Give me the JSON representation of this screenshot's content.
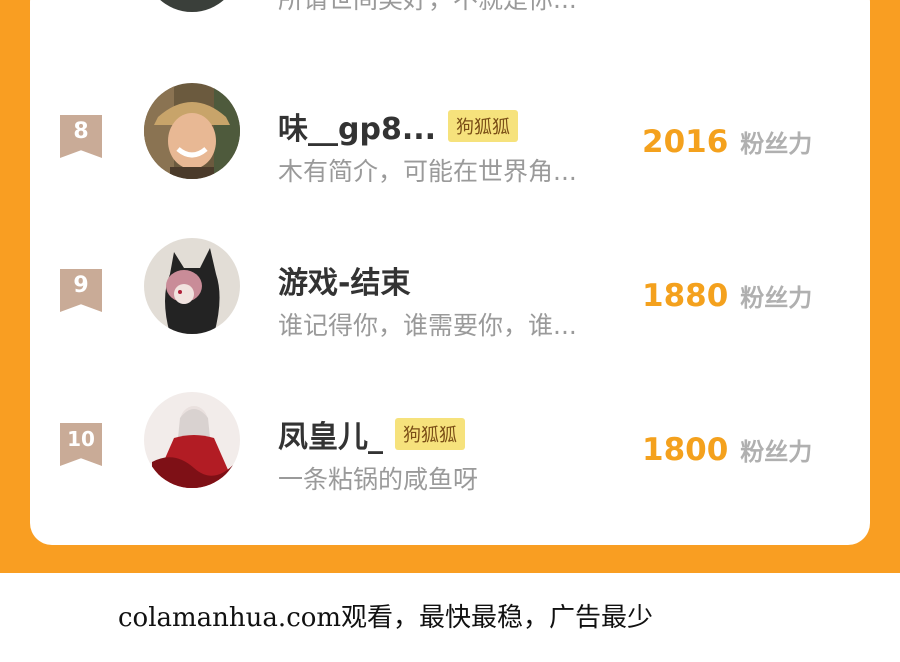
{
  "colors": {
    "frame": "#f99e22",
    "card": "#ffffff",
    "rank_flag": "#c9ab97",
    "fan_count": "#f4a11d",
    "badge_bg": "#f6e27c"
  },
  "top_row": {
    "bio": "所谓世间美好，不就是你..."
  },
  "rows": [
    {
      "rank": "8",
      "name": "味__gp8...",
      "badge": "狗狐狐",
      "bio": "木有简介，可能在世界角...",
      "fans": "2016",
      "fans_label": "粉丝力",
      "avatar_icon": "avatar-boy-photo"
    },
    {
      "rank": "9",
      "name": "游戏-结束",
      "badge": "",
      "bio": "谁记得你，谁需要你，谁...",
      "fans": "1880",
      "fans_label": "粉丝力",
      "avatar_icon": "avatar-anime-cat-hood"
    },
    {
      "rank": "10",
      "name": "凤皇儿_",
      "badge": "狗狐狐",
      "bio": "一条粘锅的咸鱼呀",
      "fans": "1800",
      "fans_label": "粉丝力",
      "avatar_icon": "avatar-anime-red-dress"
    }
  ],
  "footer": {
    "text": "colamanhua.com观看，最快最稳，广告最少"
  }
}
